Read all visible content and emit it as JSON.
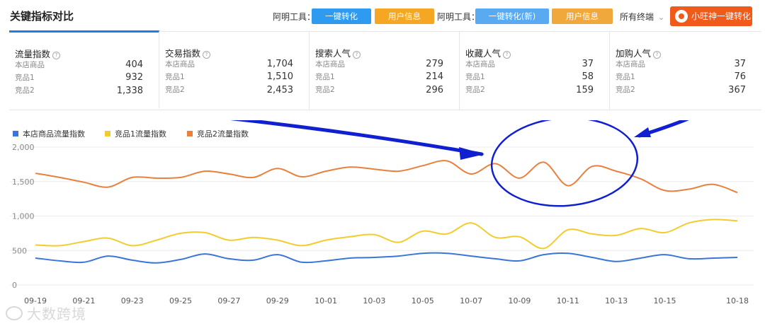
{
  "header": {
    "title": "关键指标对比",
    "tool_label_1": "阿明工具：",
    "btn_convert": "一键转化",
    "btn_userinfo": "用户信息",
    "tool_label_2": "阿明工具：",
    "btn_convert_new": "一键转化(新)",
    "btn_userinfo_2": "用户信息",
    "terminal_select": "所有终端",
    "promo_button": "小旺神一键转化"
  },
  "metrics": [
    {
      "title": "流量指数",
      "rows": [
        {
          "label": "本店商品",
          "value": "404"
        },
        {
          "label": "竞品1",
          "value": "932"
        },
        {
          "label": "竞品2",
          "value": "1,338"
        }
      ]
    },
    {
      "title": "交易指数",
      "rows": [
        {
          "label": "本店商品",
          "value": "1,704"
        },
        {
          "label": "竞品1",
          "value": "1,510"
        },
        {
          "label": "竞品2",
          "value": "2,453"
        }
      ]
    },
    {
      "title": "搜索人气",
      "rows": [
        {
          "label": "本店商品",
          "value": "279"
        },
        {
          "label": "竞品1",
          "value": "214"
        },
        {
          "label": "竞品2",
          "value": "296"
        }
      ]
    },
    {
      "title": "收藏人气",
      "rows": [
        {
          "label": "本店商品",
          "value": "37"
        },
        {
          "label": "竞品1",
          "value": "58"
        },
        {
          "label": "竞品2",
          "value": "159"
        }
      ]
    },
    {
      "title": "加购人气",
      "rows": [
        {
          "label": "本店商品",
          "value": "37"
        },
        {
          "label": "竞品1",
          "value": "76"
        },
        {
          "label": "竞品2",
          "value": "367"
        }
      ]
    }
  ],
  "colors": {
    "own": "#3a75d8",
    "competitor1": "#f2cc2e",
    "competitor2": "#e8803e",
    "annotation": "#1020d0",
    "active_tab": "#1e7fe0"
  },
  "chart_data": {
    "type": "line",
    "x": [
      "09-19",
      "09-20",
      "09-21",
      "09-22",
      "09-23",
      "09-24",
      "09-25",
      "09-26",
      "09-27",
      "09-28",
      "09-29",
      "09-30",
      "10-01",
      "10-02",
      "10-03",
      "10-04",
      "10-05",
      "10-06",
      "10-07",
      "10-08",
      "10-09",
      "10-10",
      "10-11",
      "10-12",
      "10-13",
      "10-14",
      "10-15",
      "10-16",
      "10-17",
      "10-18"
    ],
    "tick_labels": [
      "09-19",
      "09-21",
      "09-23",
      "09-25",
      "09-27",
      "09-29",
      "10-01",
      "10-03",
      "10-05",
      "10-07",
      "10-09",
      "10-11",
      "10-13",
      "10-15",
      "10-18"
    ],
    "series": [
      {
        "name": "本店商品流量指数",
        "values": [
          390,
          350,
          330,
          420,
          360,
          320,
          370,
          450,
          380,
          360,
          440,
          330,
          350,
          390,
          400,
          420,
          460,
          460,
          420,
          380,
          350,
          440,
          460,
          400,
          340,
          390,
          440,
          380,
          390,
          400
        ]
      },
      {
        "name": "竞品1流量指数",
        "values": [
          580,
          570,
          630,
          680,
          570,
          650,
          750,
          760,
          650,
          690,
          650,
          570,
          650,
          700,
          730,
          620,
          780,
          740,
          900,
          690,
          700,
          530,
          800,
          740,
          720,
          820,
          760,
          900,
          950,
          930
        ]
      },
      {
        "name": "竞品2流量指数",
        "values": [
          1620,
          1560,
          1490,
          1420,
          1560,
          1550,
          1560,
          1650,
          1610,
          1560,
          1690,
          1570,
          1650,
          1710,
          1680,
          1650,
          1730,
          1800,
          1610,
          1760,
          1550,
          1780,
          1440,
          1720,
          1650,
          1540,
          1370,
          1390,
          1460,
          1340
        ]
      }
    ],
    "y_ticks": [
      "2,000",
      "1,500",
      "1,000",
      "500",
      "0"
    ],
    "ylim": [
      0,
      2000
    ],
    "grid": true,
    "legend_position": "top-left"
  }
}
